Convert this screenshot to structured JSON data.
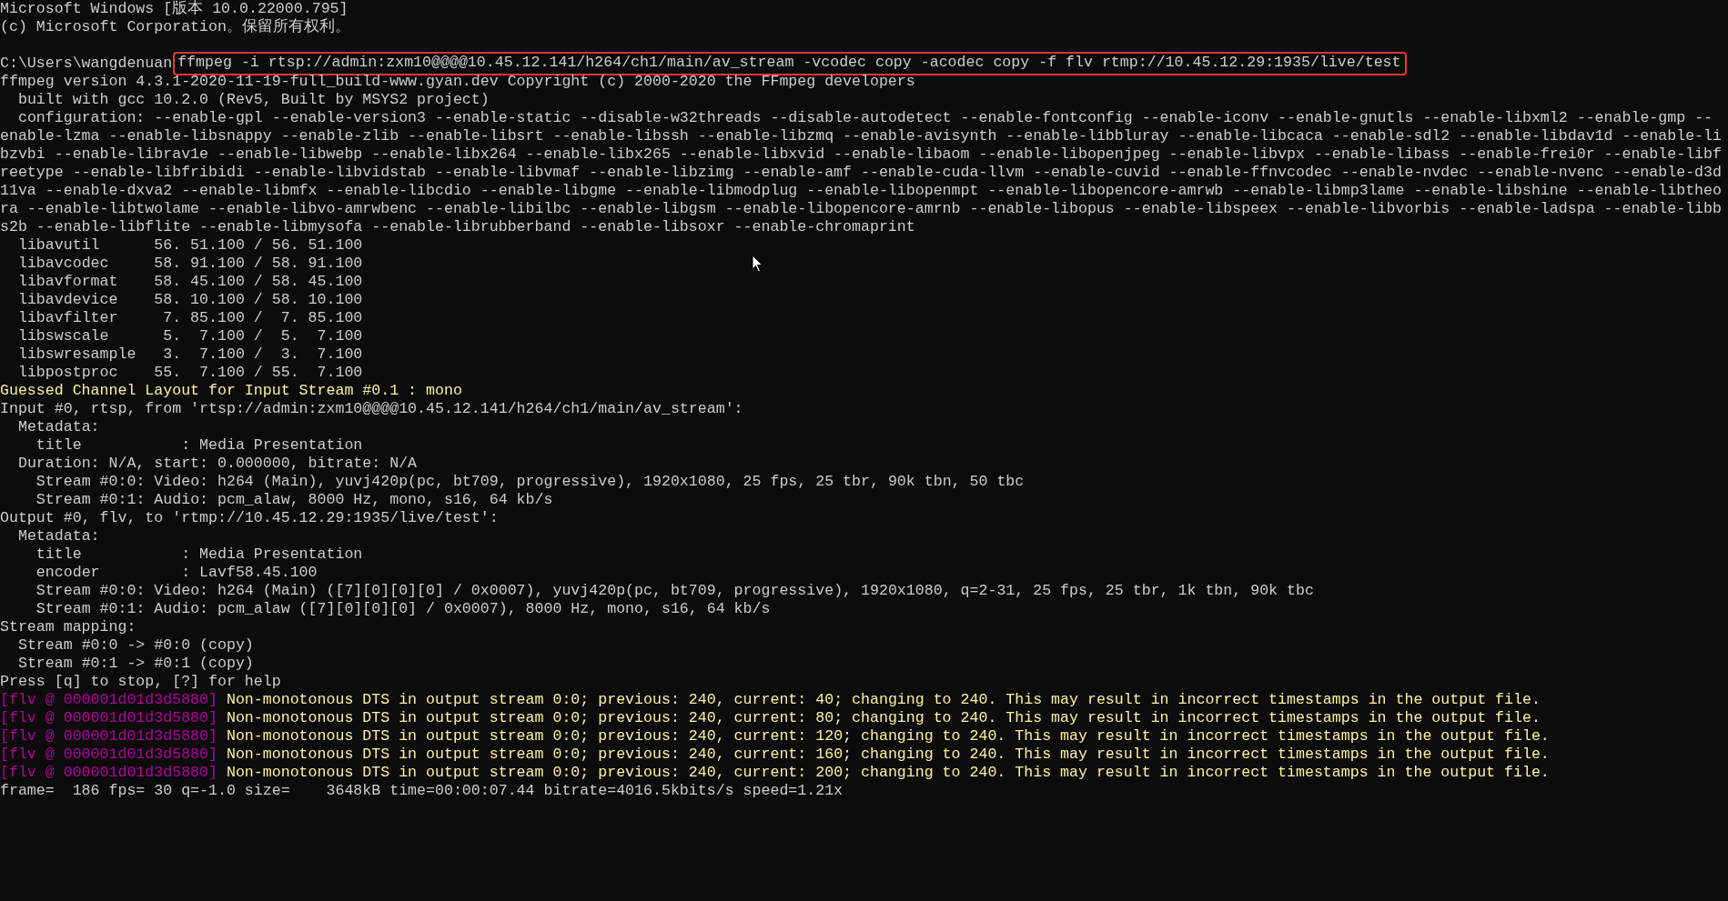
{
  "console": {
    "lines": [
      {
        "kind": "plain",
        "text": "Microsoft Windows [版本 10.0.22000.795]"
      },
      {
        "kind": "plain",
        "text": "(c) Microsoft Corporation。保留所有权利。"
      },
      {
        "kind": "command",
        "prompt": "C:\\Users\\wangdenuan",
        "text": "ffmpeg -i rtsp://admin:zxm10@@@@10.45.12.141/h264/ch1/main/av_stream -vcodec copy -acodec copy -f flv rtmp://10.45.12.29:1935/live/test"
      },
      {
        "kind": "plain",
        "text": "ffmpeg version 4.3.1-2020-11-19-full_build-www.gyan.dev Copyright (c) 2000-2020 the FFmpeg developers"
      },
      {
        "kind": "plain",
        "text": "  built with gcc 10.2.0 (Rev5, Built by MSYS2 project)"
      },
      {
        "kind": "plain",
        "text": "  configuration: --enable-gpl --enable-version3 --enable-static --disable-w32threads --disable-autodetect --enable-fontconfig --enable-iconv --enable-gnutls --enable-libxml2 --enable-gmp --enable-lzma --enable-libsnappy --enable-zlib --enable-libsrt --enable-libssh --enable-libzmq --enable-avisynth --enable-libbluray --enable-libcaca --enable-sdl2 --enable-libdav1d --enable-libzvbi --enable-librav1e --enable-libwebp --enable-libx264 --enable-libx265 --enable-libxvid --enable-libaom --enable-libopenjpeg --enable-libvpx --enable-libass --enable-frei0r --enable-libfreetype --enable-libfribidi --enable-libvidstab --enable-libvmaf --enable-libzimg --enable-amf --enable-cuda-llvm --enable-cuvid --enable-ffnvcodec --enable-nvdec --enable-nvenc --enable-d3d11va --enable-dxva2 --enable-libmfx --enable-libcdio --enable-libgme --enable-libmodplug --enable-libopenmpt --enable-libopencore-amrwb --enable-libmp3lame --enable-libshine --enable-libtheora --enable-libtwolame --enable-libvo-amrwbenc --enable-libilbc --enable-libgsm --enable-libopencore-amrnb --enable-libopus --enable-libspeex --enable-libvorbis --enable-ladspa --enable-libbs2b --enable-libflite --enable-libmysofa --enable-librubberband --enable-libsoxr --enable-chromaprint"
      },
      {
        "kind": "plain",
        "text": "  libavutil      56. 51.100 / 56. 51.100"
      },
      {
        "kind": "plain",
        "text": "  libavcodec     58. 91.100 / 58. 91.100"
      },
      {
        "kind": "plain",
        "text": "  libavformat    58. 45.100 / 58. 45.100"
      },
      {
        "kind": "plain",
        "text": "  libavdevice    58. 10.100 / 58. 10.100"
      },
      {
        "kind": "plain",
        "text": "  libavfilter     7. 85.100 /  7. 85.100"
      },
      {
        "kind": "plain",
        "text": "  libswscale      5.  7.100 /  5.  7.100"
      },
      {
        "kind": "plain",
        "text": "  libswresample   3.  7.100 /  3.  7.100"
      },
      {
        "kind": "plain",
        "text": "  libpostproc    55.  7.100 / 55.  7.100"
      },
      {
        "kind": "notice",
        "text": "Guessed Channel Layout for Input Stream #0.1 : mono"
      },
      {
        "kind": "plain",
        "text": "Input #0, rtsp, from 'rtsp://admin:zxm10@@@@10.45.12.141/h264/ch1/main/av_stream':"
      },
      {
        "kind": "plain",
        "text": "  Metadata:"
      },
      {
        "kind": "plain",
        "text": "    title           : Media Presentation"
      },
      {
        "kind": "plain",
        "text": "  Duration: N/A, start: 0.000000, bitrate: N/A"
      },
      {
        "kind": "plain",
        "text": "    Stream #0:0: Video: h264 (Main), yuvj420p(pc, bt709, progressive), 1920x1080, 25 fps, 25 tbr, 90k tbn, 50 tbc"
      },
      {
        "kind": "plain",
        "text": "    Stream #0:1: Audio: pcm_alaw, 8000 Hz, mono, s16, 64 kb/s"
      },
      {
        "kind": "plain",
        "text": "Output #0, flv, to 'rtmp://10.45.12.29:1935/live/test':"
      },
      {
        "kind": "plain",
        "text": "  Metadata:"
      },
      {
        "kind": "plain",
        "text": "    title           : Media Presentation"
      },
      {
        "kind": "plain",
        "text": "    encoder         : Lavf58.45.100"
      },
      {
        "kind": "plain",
        "text": "    Stream #0:0: Video: h264 (Main) ([7][0][0][0] / 0x0007), yuvj420p(pc, bt709, progressive), 1920x1080, q=2-31, 25 fps, 25 tbr, 1k tbn, 90k tbc"
      },
      {
        "kind": "plain",
        "text": "    Stream #0:1: Audio: pcm_alaw ([7][0][0][0] / 0x0007), 8000 Hz, mono, s16, 64 kb/s"
      },
      {
        "kind": "plain",
        "text": "Stream mapping:"
      },
      {
        "kind": "plain",
        "text": "  Stream #0:0 -> #0:0 (copy)"
      },
      {
        "kind": "plain",
        "text": "  Stream #0:1 -> #0:1 (copy)"
      },
      {
        "kind": "plain",
        "text": "Press [q] to stop, [?] for help"
      },
      {
        "kind": "warning",
        "prefix": "[flv @ 000001d01d3d5880]",
        "text": "Non-monotonous DTS in output stream 0:0; previous: 240, current: 40; changing to 240. This may result in incorrect timestamps in the output file."
      },
      {
        "kind": "warning",
        "prefix": "[flv @ 000001d01d3d5880]",
        "text": "Non-monotonous DTS in output stream 0:0; previous: 240, current: 80; changing to 240. This may result in incorrect timestamps in the output file."
      },
      {
        "kind": "warning",
        "prefix": "[flv @ 000001d01d3d5880]",
        "text": "Non-monotonous DTS in output stream 0:0; previous: 240, current: 120; changing to 240. This may result in incorrect timestamps in the output file."
      },
      {
        "kind": "warning",
        "prefix": "[flv @ 000001d01d3d5880]",
        "text": "Non-monotonous DTS in output stream 0:0; previous: 240, current: 160; changing to 240. This may result in incorrect timestamps in the output file."
      },
      {
        "kind": "warning",
        "prefix": "[flv @ 000001d01d3d5880]",
        "text": "Non-monotonous DTS in output stream 0:0; previous: 240, current: 200; changing to 240. This may result in incorrect timestamps in the output file."
      },
      {
        "kind": "plain",
        "text": "frame=  186 fps= 30 q=-1.0 size=    3648kB time=00:00:07.44 bitrate=4016.5kbits/s speed=1.21x"
      }
    ]
  }
}
